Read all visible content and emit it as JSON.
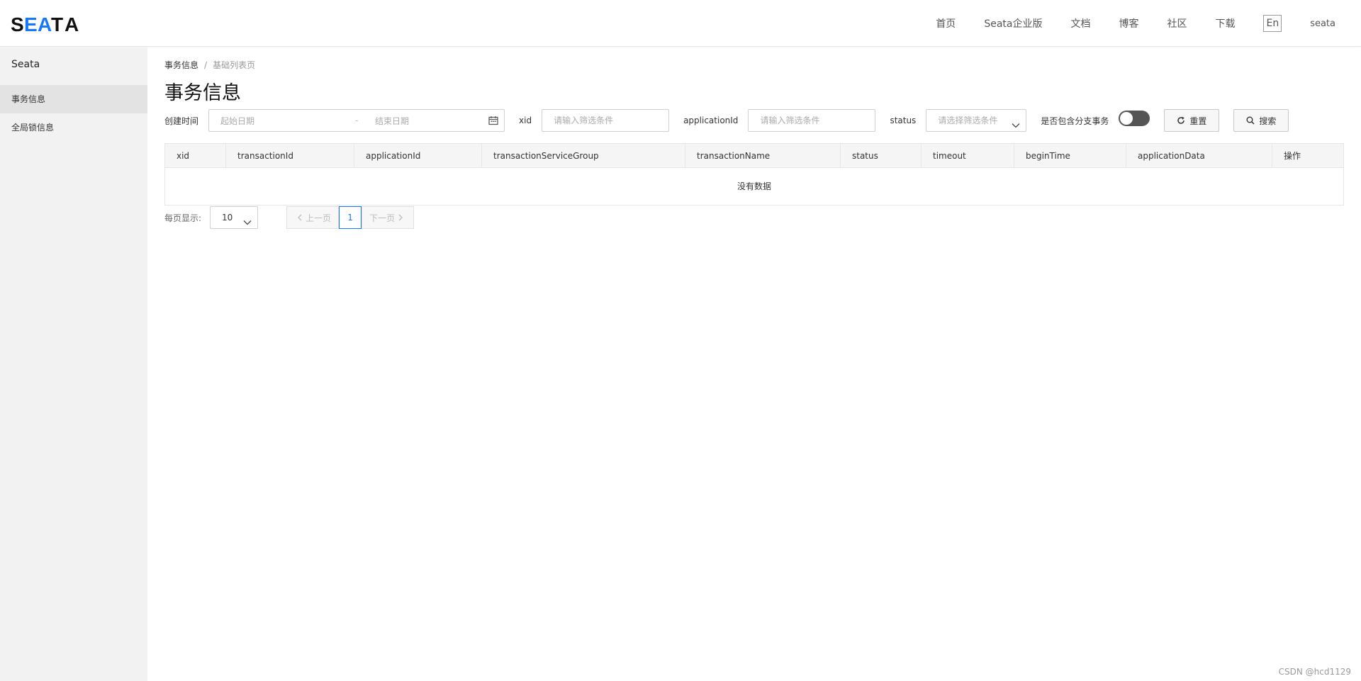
{
  "header": {
    "logo": {
      "letters": [
        "S",
        "E",
        "A",
        "T",
        "A"
      ],
      "accent_color": "#1677ff"
    },
    "nav": [
      "首页",
      "Seata企业版",
      "文档",
      "博客",
      "社区",
      "下载"
    ],
    "lang": "En",
    "user": "seata"
  },
  "sidebar": {
    "title": "Seata",
    "items": [
      {
        "label": "事务信息",
        "active": true
      },
      {
        "label": "全局锁信息",
        "active": false
      }
    ]
  },
  "breadcrumb": {
    "parent": "事务信息",
    "separator": "/",
    "current": "基础列表页"
  },
  "page_title": "事务信息",
  "filters": {
    "created_label": "创建时间",
    "start_placeholder": "起始日期",
    "range_dash": "-",
    "end_placeholder": "结束日期",
    "xid_label": "xid",
    "xid_placeholder": "请输入筛选条件",
    "app_label": "applicationId",
    "app_placeholder": "请输入筛选条件",
    "status_label": "status",
    "status_placeholder": "请选择筛选条件",
    "branch_label": "是否包含分支事务",
    "branch_on": false,
    "reset_label": "重置",
    "search_label": "搜索"
  },
  "table": {
    "columns": [
      "xid",
      "transactionId",
      "applicationId",
      "transactionServiceGroup",
      "transactionName",
      "status",
      "timeout",
      "beginTime",
      "applicationData",
      "操作"
    ],
    "empty_text": "没有数据"
  },
  "pagination": {
    "per_page_label": "每页显示:",
    "page_size": "10",
    "prev_label": "上一页",
    "current_page": "1",
    "next_label": "下一页"
  },
  "watermark": "CSDN @hcd1129"
}
